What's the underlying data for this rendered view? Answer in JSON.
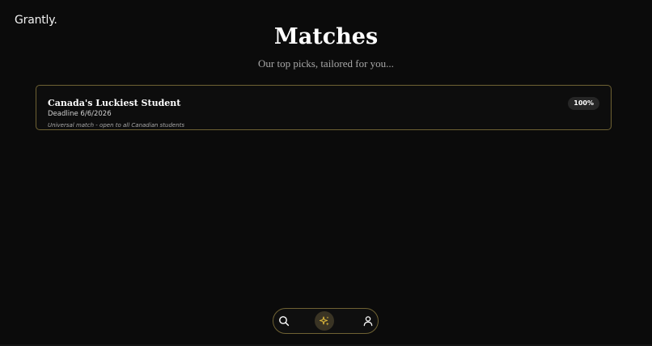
{
  "app": {
    "logo": "Grantly."
  },
  "header": {
    "title": "Matches",
    "subtitle": "Our top picks, tailored for you..."
  },
  "matches": [
    {
      "title": "Canada's Luckiest Student",
      "deadline": "Deadline 6/6/2026",
      "note": "Universal match - open to all Canadian students",
      "score": "100%"
    }
  ],
  "nav": {
    "items": [
      {
        "icon": "search-icon",
        "active": false
      },
      {
        "icon": "sparkles-icon",
        "active": true
      },
      {
        "icon": "user-icon",
        "active": false
      }
    ],
    "accent": "#d8b43a",
    "border": "#6f6233"
  }
}
